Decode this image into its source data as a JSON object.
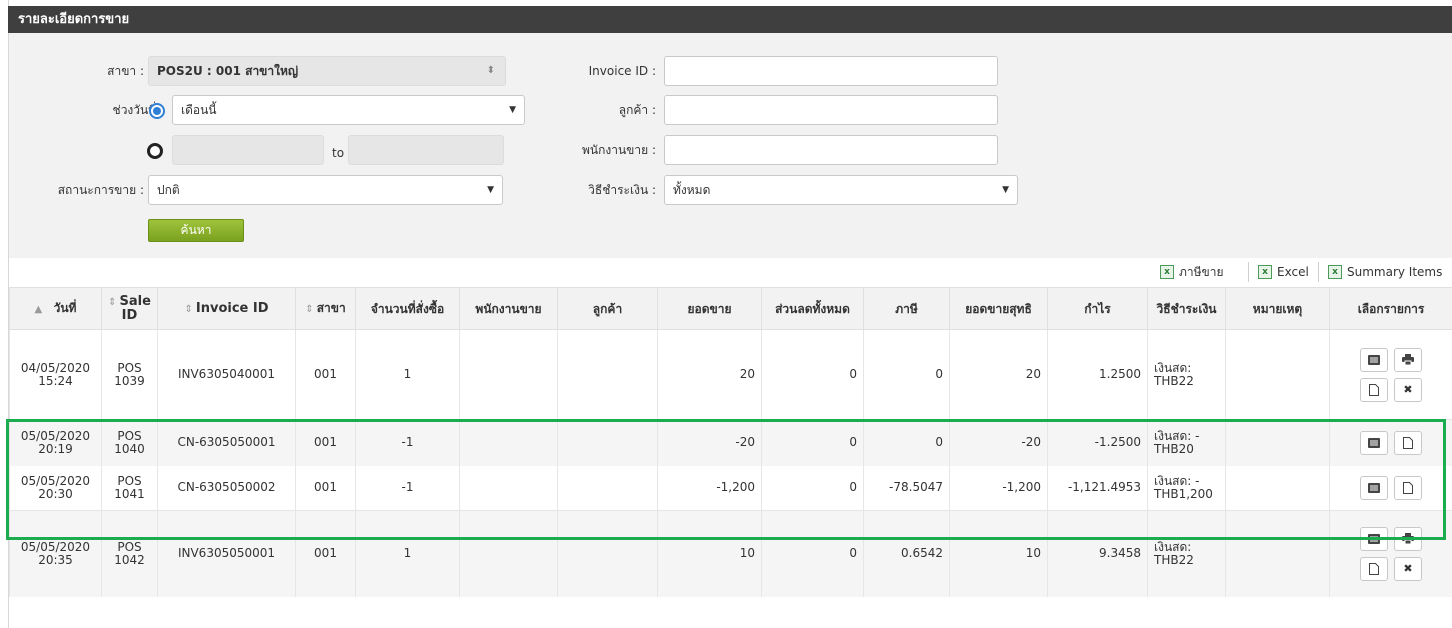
{
  "header": {
    "title": "รายละเอียดการขาย"
  },
  "filters": {
    "branch_label": "สาขา :",
    "branch_value": "POS2U : 001 สาขาใหญ่",
    "date_label": "ช่วงวันที่ :",
    "date_range_value": "เดือนนี้",
    "to_label": "to",
    "status_label": "สถานะการขาย :",
    "status_value": "ปกติ",
    "invoice_label": "Invoice ID :",
    "customer_label": "ลูกค้า :",
    "salesperson_label": "พนักงานขาย :",
    "payment_label": "วิธีชำระเงิน :",
    "payment_value": "ทั้งหมด",
    "search_button": "ค้นหา"
  },
  "exports": {
    "tax": "ภาษีขาย",
    "excel": "Excel",
    "summary": "Summary Items"
  },
  "columns": {
    "date": "วันที่",
    "sale_id": "Sale ID",
    "invoice_id": "Invoice ID",
    "branch": "สาขา",
    "qty": "จำนวนที่สั่งซื้อ",
    "salesperson": "พนักงานขาย",
    "customer": "ลูกค้า",
    "sales": "ยอดขาย",
    "discount": "ส่วนลดทั้งหมด",
    "tax": "ภาษี",
    "net": "ยอดขายสุทธิ",
    "profit": "กำไร",
    "payment": "วิธีชำระเงิน",
    "note": "หมายเหตุ",
    "actions": "เลือกรายการ"
  },
  "rows": [
    {
      "date": "04/05/2020",
      "time": "15:24",
      "pos": "POS",
      "sale_no": "1039",
      "invoice": "INV6305040001",
      "branch": "001",
      "qty": "1",
      "salesperson": "",
      "customer": "",
      "sales": "20",
      "discount": "0",
      "tax": "0",
      "net": "20",
      "profit": "1.2500",
      "pay1": "เงินสด:",
      "pay2": "THB22",
      "note": ""
    },
    {
      "date": "05/05/2020",
      "time": "20:19",
      "pos": "POS",
      "sale_no": "1040",
      "invoice": "CN-6305050001",
      "branch": "001",
      "qty": "-1",
      "salesperson": "",
      "customer": "",
      "sales": "-20",
      "discount": "0",
      "tax": "0",
      "net": "-20",
      "profit": "-1.2500",
      "pay1": "เงินสด: -",
      "pay2": "THB20",
      "note": ""
    },
    {
      "date": "05/05/2020",
      "time": "20:30",
      "pos": "POS",
      "sale_no": "1041",
      "invoice": "CN-6305050002",
      "branch": "001",
      "qty": "-1",
      "salesperson": "",
      "customer": "",
      "sales": "-1,200",
      "discount": "0",
      "tax": "-78.5047",
      "net": "-1,200",
      "profit": "-1,121.4953",
      "pay1": "เงินสด: -",
      "pay2": "THB1,200",
      "note": ""
    },
    {
      "date": "05/05/2020",
      "time": "20:35",
      "pos": "POS",
      "sale_no": "1042",
      "invoice": "INV6305050001",
      "branch": "001",
      "qty": "1",
      "salesperson": "",
      "customer": "",
      "sales": "10",
      "discount": "0",
      "tax": "0.6542",
      "net": "10",
      "profit": "9.3458",
      "pay1": "เงินสด:",
      "pay2": "THB22",
      "note": ""
    }
  ],
  "icons": {
    "view": "list-icon",
    "print": "printer-icon",
    "doc": "document-icon",
    "delete": "close-icon"
  },
  "colors": {
    "title_bar": "#3f3f3f",
    "search_button": "#8cb42c",
    "highlight": "#1aac4e",
    "radio_active": "#2f7fd6"
  }
}
